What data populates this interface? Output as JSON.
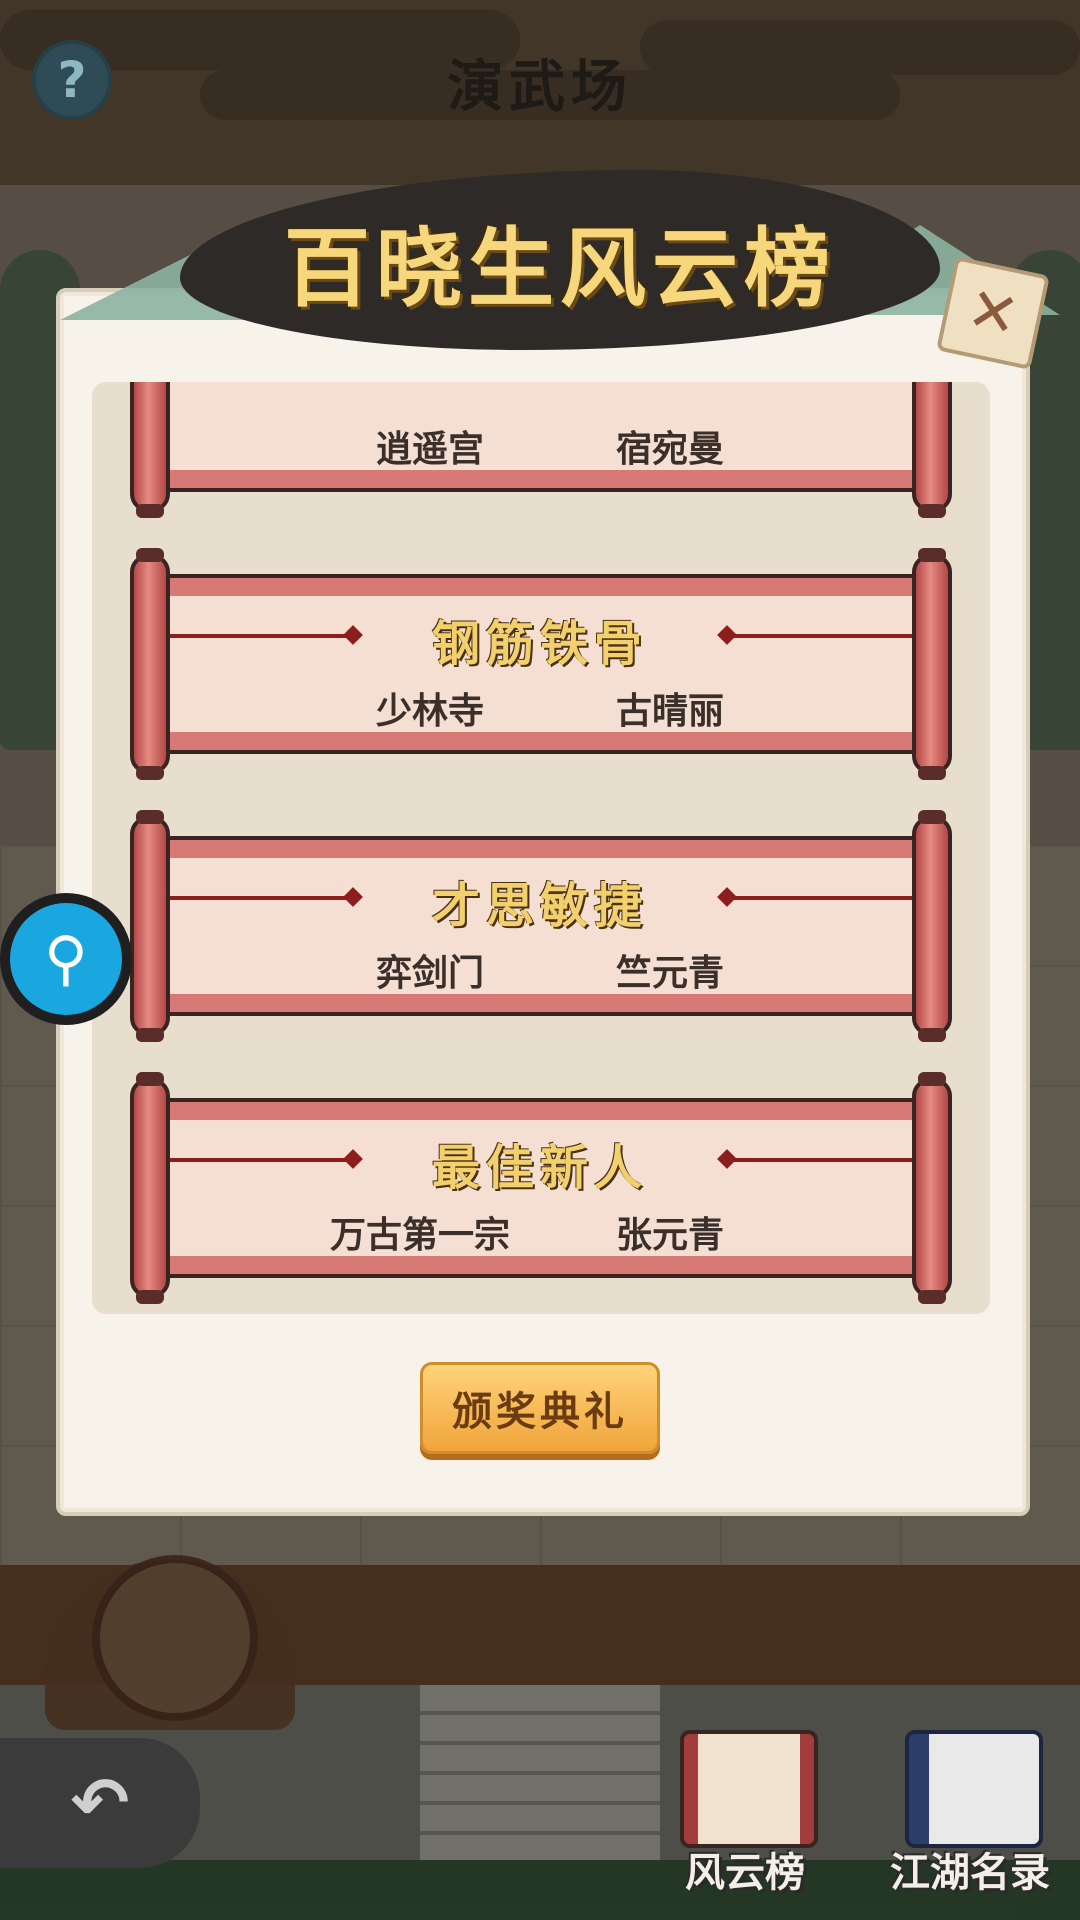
{
  "header": {
    "title": "演武场",
    "help_icon": "?"
  },
  "modal": {
    "title": "百晓生风云榜",
    "close_icon": "✕",
    "awards": [
      {
        "title": "",
        "sect": "逍遥宫",
        "name": "宿宛曼"
      },
      {
        "title": "钢筋铁骨",
        "sect": "少林寺",
        "name": "古晴丽"
      },
      {
        "title": "才思敏捷",
        "sect": "弈剑门",
        "name": "竺元青"
      },
      {
        "title": "最佳新人",
        "sect": "万古第一宗",
        "name": "张元青"
      }
    ],
    "ceremony_button": "颁奖典礼"
  },
  "bottom_nav": {
    "items": [
      {
        "label": "风云榜",
        "icon": "scroll-icon"
      },
      {
        "label": "江湖名录",
        "icon": "book-icon"
      }
    ]
  },
  "colors": {
    "accent_gold": "#f6d77c",
    "scroll_red": "#d77a75",
    "button_orange": "#f0a43a",
    "zoom_blue": "#1aa7e0"
  }
}
